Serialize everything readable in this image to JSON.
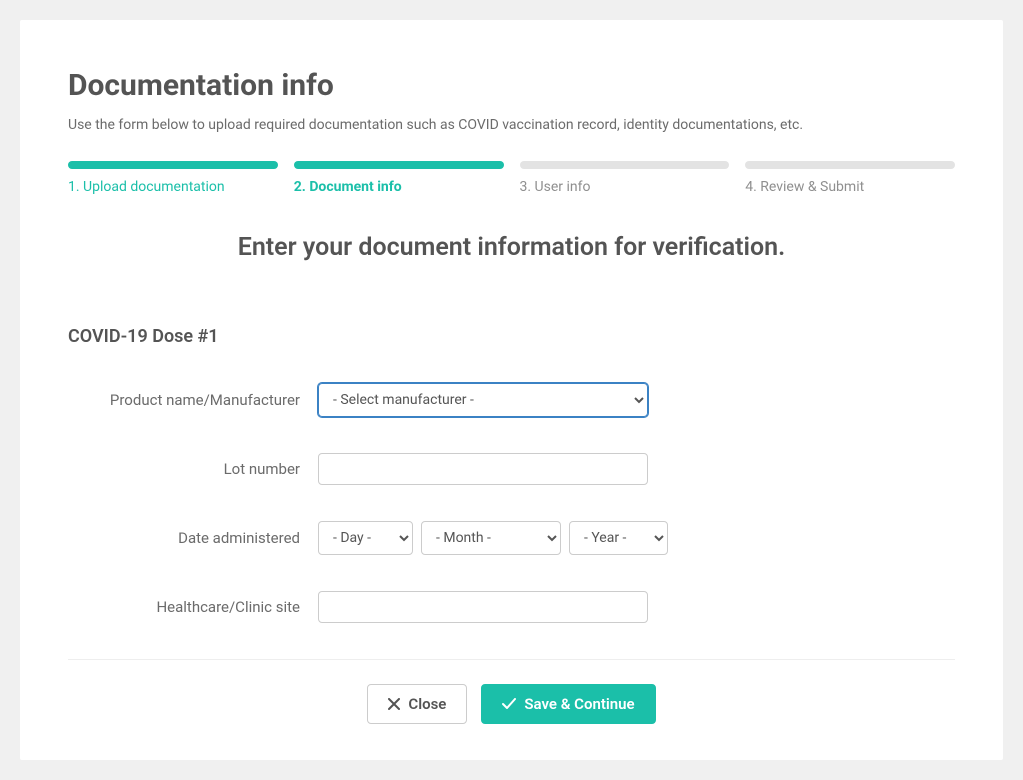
{
  "page": {
    "title": "Documentation info",
    "description": "Use the form below to upload required documentation such as COVID vaccination record, identity documentations, etc."
  },
  "stepper": {
    "steps": [
      {
        "label": "1. Upload documentation",
        "state": "completed"
      },
      {
        "label": "2. Document info",
        "state": "active"
      },
      {
        "label": "3. User info",
        "state": "upcoming"
      },
      {
        "label": "4. Review & Submit",
        "state": "upcoming"
      }
    ]
  },
  "form": {
    "heading": "Enter your document information for verification.",
    "section_heading": "COVID-19 Dose #1",
    "fields": {
      "manufacturer": {
        "label": "Product name/Manufacturer",
        "placeholder": "- Select manufacturer -",
        "value": ""
      },
      "lot_number": {
        "label": "Lot number",
        "value": ""
      },
      "date_administered": {
        "label": "Date administered",
        "day_placeholder": "- Day -",
        "month_placeholder": "- Month -",
        "year_placeholder": "- Year -"
      },
      "clinic_site": {
        "label": "Healthcare/Clinic site",
        "value": ""
      }
    }
  },
  "actions": {
    "close": "Close",
    "save": "Save & Continue"
  }
}
